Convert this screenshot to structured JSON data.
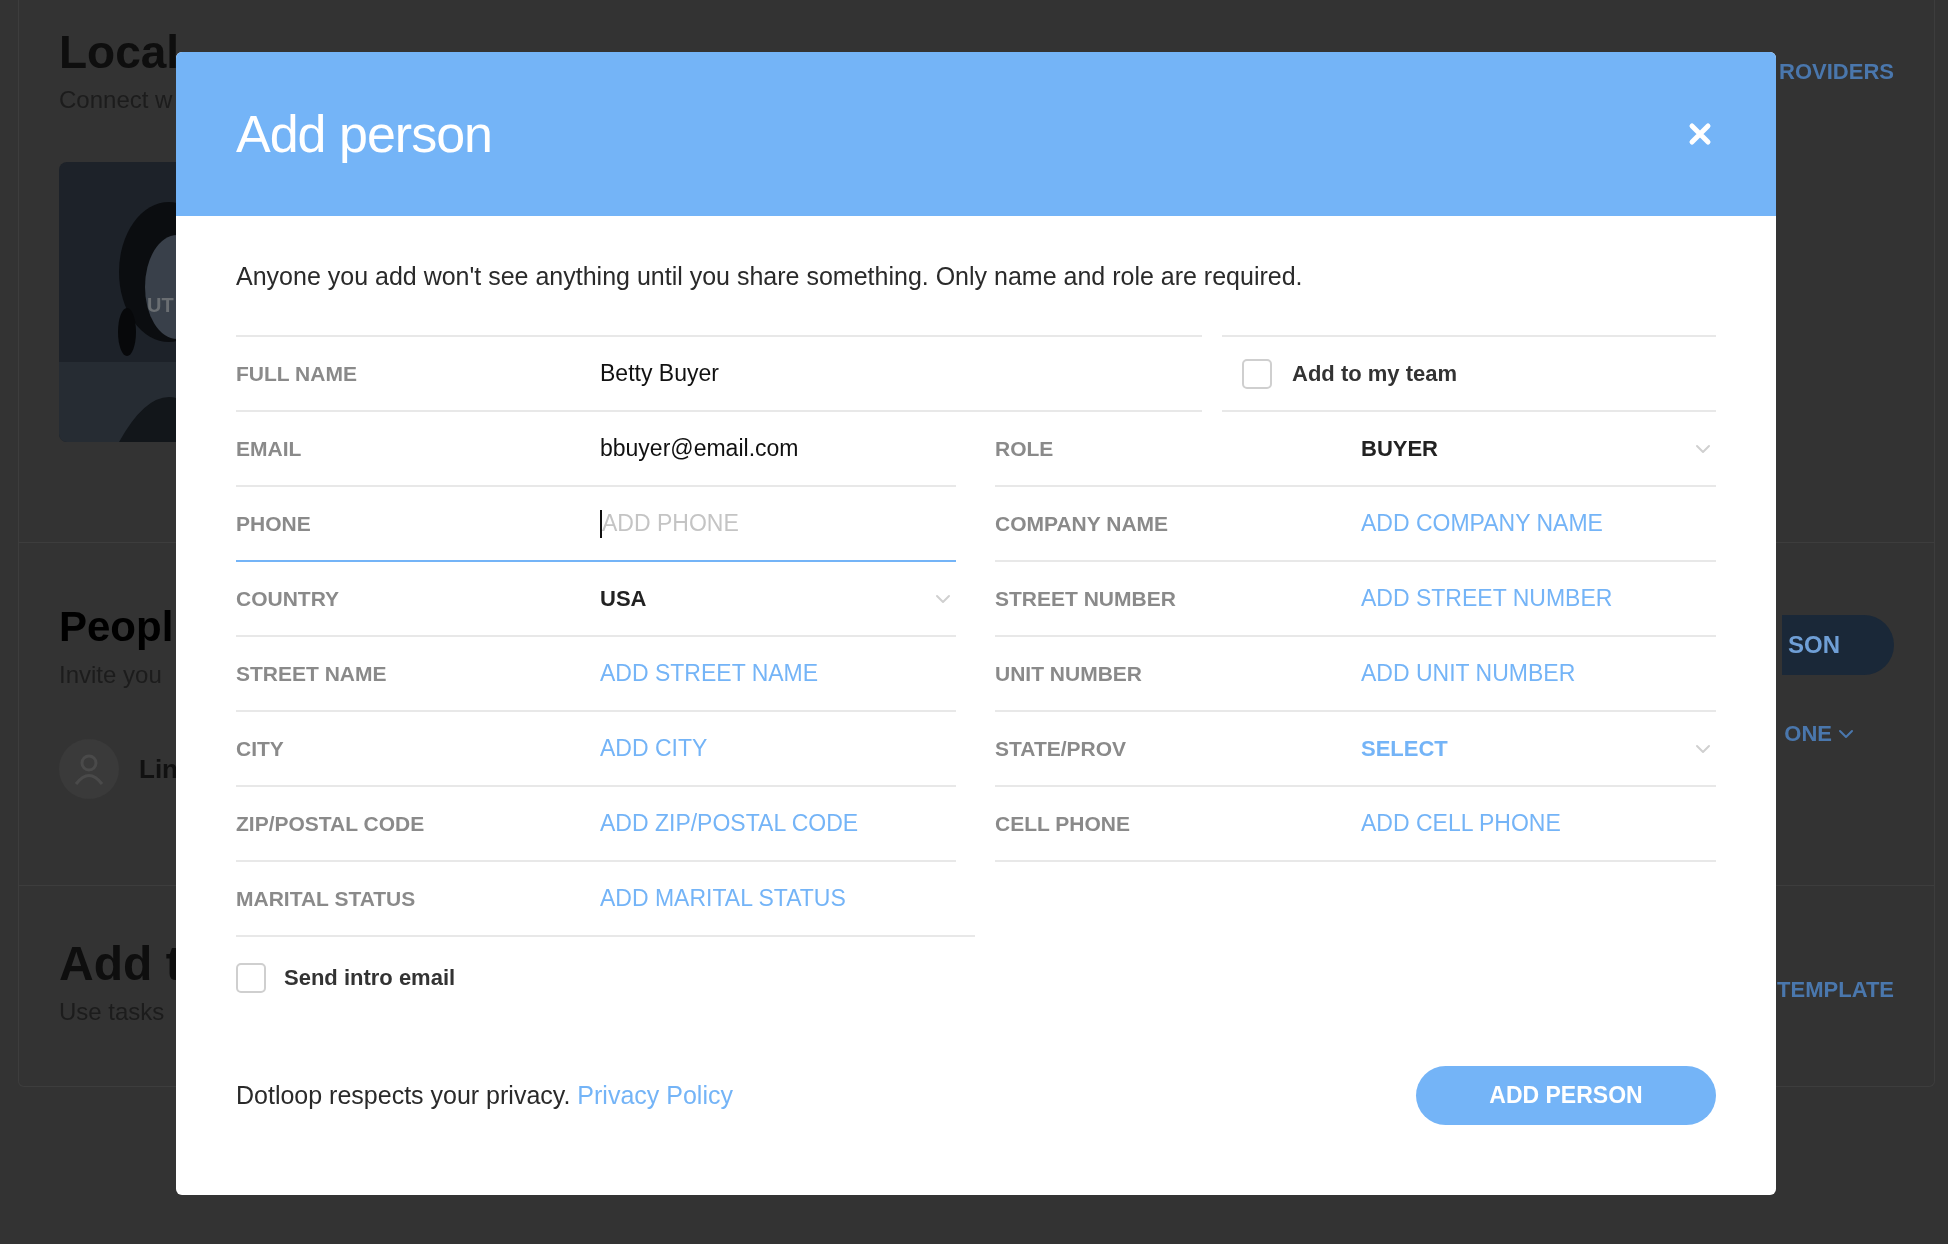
{
  "background_page": {
    "providers": {
      "title": "Local",
      "subtitle": "Connect w",
      "card_label": "UT",
      "action": "ROVIDERS"
    },
    "people": {
      "title": "Peopl",
      "subtitle": "Invite you",
      "person": "Lin",
      "button": "SON",
      "menu": "ONE"
    },
    "tasks": {
      "title": "Add t",
      "subtitle": "Use tasks",
      "action": "TEMPLATE"
    }
  },
  "dialog": {
    "title": "Add person",
    "intro": "Anyone you add won't see anything until you share something. Only name and role are required.",
    "full_name": {
      "label": "FULL NAME",
      "value": "Betty Buyer"
    },
    "team_checkbox": {
      "label": "Add to my team",
      "checked": false
    },
    "left_fields": [
      {
        "kind": "text",
        "label": "EMAIL",
        "value": "bbuyer@email.com",
        "focused": false
      },
      {
        "kind": "text",
        "label": "PHONE",
        "placeholder": "ADD PHONE",
        "focused": true
      },
      {
        "kind": "select",
        "label": "COUNTRY",
        "value": "USA",
        "focused": false
      },
      {
        "kind": "text",
        "label": "STREET NAME",
        "placeholder": "ADD STREET NAME",
        "focused": false
      },
      {
        "kind": "text",
        "label": "CITY",
        "placeholder": "ADD CITY",
        "focused": false
      },
      {
        "kind": "text",
        "label": "ZIP/POSTAL CODE",
        "placeholder": "ADD ZIP/POSTAL CODE",
        "focused": false
      },
      {
        "kind": "text",
        "label": "MARITAL STATUS",
        "placeholder": "ADD MARITAL STATUS",
        "focused": false
      }
    ],
    "right_fields": [
      {
        "kind": "select",
        "label": "ROLE",
        "value": "BUYER",
        "focused": false
      },
      {
        "kind": "text",
        "label": "COMPANY NAME",
        "placeholder": "ADD COMPANY NAME",
        "focused": false
      },
      {
        "kind": "text",
        "label": "STREET NUMBER",
        "placeholder": "ADD STREET NUMBER",
        "focused": false
      },
      {
        "kind": "text",
        "label": "UNIT NUMBER",
        "placeholder": "ADD UNIT NUMBER",
        "focused": false
      },
      {
        "kind": "select",
        "label": "STATE/PROV",
        "placeholder": "SELECT",
        "focused": false
      },
      {
        "kind": "text",
        "label": "CELL PHONE",
        "placeholder": "ADD CELL PHONE",
        "focused": false
      }
    ],
    "intro_checkbox": {
      "label": "Send intro email",
      "checked": false
    },
    "privacy_note": "Dotloop respects your privacy.",
    "privacy_link": "Privacy Policy",
    "submit_button": "ADD PERSON"
  }
}
